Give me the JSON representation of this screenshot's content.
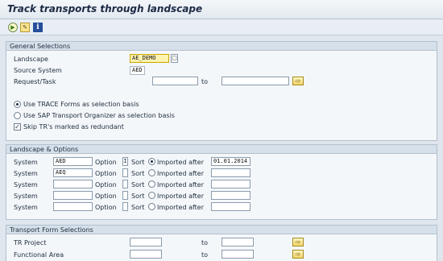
{
  "window": {
    "title": "Track transports through landscape"
  },
  "toolbar": {
    "execute_icon": "execute-icon",
    "variant_icon": "get-variant-icon",
    "info_icon": "info-icon",
    "info_glyph": "i"
  },
  "general": {
    "header": "General Selections",
    "landscape_label": "Landscape",
    "landscape_value": "AE_DEMO",
    "source_label": "Source System",
    "source_value": "AED",
    "request_label": "Request/Task",
    "to_label": "to",
    "opt_trace": "Use TRACE Forms as selection basis",
    "opt_organizer": "Use SAP Transport Organizer as selection basis",
    "skip_label": "Skip TR's marked as redundant"
  },
  "landscape_options": {
    "header": "Landscape & Options",
    "system_label": "System",
    "option_label": "Option",
    "sort_label": "Sort",
    "imported_after_label": "Imported after",
    "rows": [
      {
        "system": "AED",
        "option": "I",
        "imported_after": "01.01.2014"
      },
      {
        "system": "AEQ",
        "option": "",
        "imported_after": ""
      },
      {
        "system": "",
        "option": "",
        "imported_after": ""
      },
      {
        "system": "",
        "option": "",
        "imported_after": ""
      },
      {
        "system": "",
        "option": "",
        "imported_after": ""
      }
    ]
  },
  "transport_form": {
    "header": "Transport Form Selections",
    "to_label": "to",
    "rows": [
      {
        "label": "TR Project"
      },
      {
        "label": "Functional Area"
      }
    ]
  }
}
